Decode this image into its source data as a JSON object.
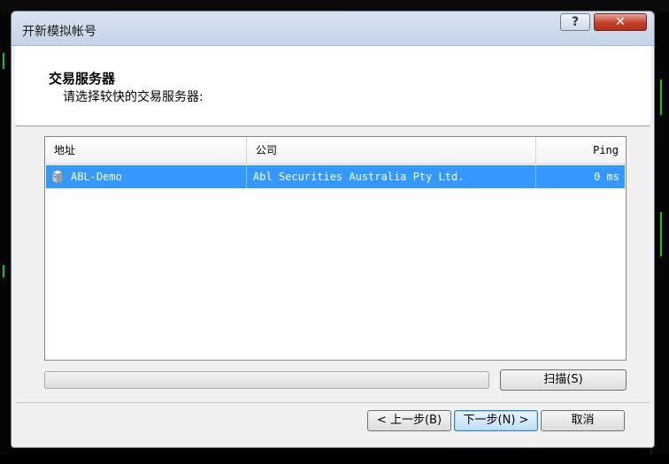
{
  "window": {
    "title": "开新模拟帐号",
    "help_label": "?",
    "close_label": "✕"
  },
  "header": {
    "title": "交易服务器",
    "subtitle": "请选择较快的交易服务器:"
  },
  "list": {
    "columns": {
      "address": "地址",
      "company": "公司",
      "ping": "Ping"
    },
    "rows": [
      {
        "address": "ABL-Demo",
        "company": "Abl Securities Australia Pty Ltd.",
        "ping": "0 ms",
        "icon": "server-icon",
        "selected": true
      }
    ]
  },
  "buttons": {
    "scan": "扫描(S)",
    "back": "< 上一步(B)",
    "next": "下一步(N) >",
    "cancel": "取消"
  },
  "colors": {
    "selection": "#3399ff",
    "titlebar": "#c4d3e6",
    "close": "#c4402a"
  }
}
